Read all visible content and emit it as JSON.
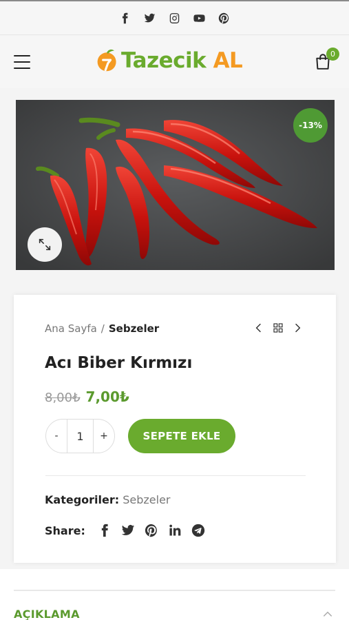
{
  "social": {
    "icons": [
      "facebook-icon",
      "twitter-icon",
      "instagram-icon",
      "youtube-icon",
      "pinterest-icon"
    ]
  },
  "header": {
    "logo_part1": "Tazecik",
    "logo_part2": "AL",
    "cart_count": "0"
  },
  "product": {
    "sale_badge": "-13%",
    "breadcrumb_home": "Ana Sayfa",
    "breadcrumb_sep": "/",
    "breadcrumb_current": "Sebzeler",
    "title": "Acı Biber Kırmızı",
    "old_price": "8,00₺",
    "new_price": "7,00₺",
    "qty_minus": "-",
    "qty_value": "1",
    "qty_plus": "+",
    "add_to_cart": "SEPETE EKLE",
    "categories_label": "Kategoriler:",
    "categories_value": "Sebzeler",
    "share_label": "Share:",
    "share_icons": [
      "facebook-icon",
      "twitter-icon",
      "pinterest-icon",
      "linkedin-icon",
      "telegram-icon"
    ]
  },
  "description": {
    "title": "AÇIKLAMA"
  },
  "colors": {
    "brand_green": "#6aab2e",
    "brand_orange": "#f49a22",
    "sale_green": "#4f9a34"
  }
}
